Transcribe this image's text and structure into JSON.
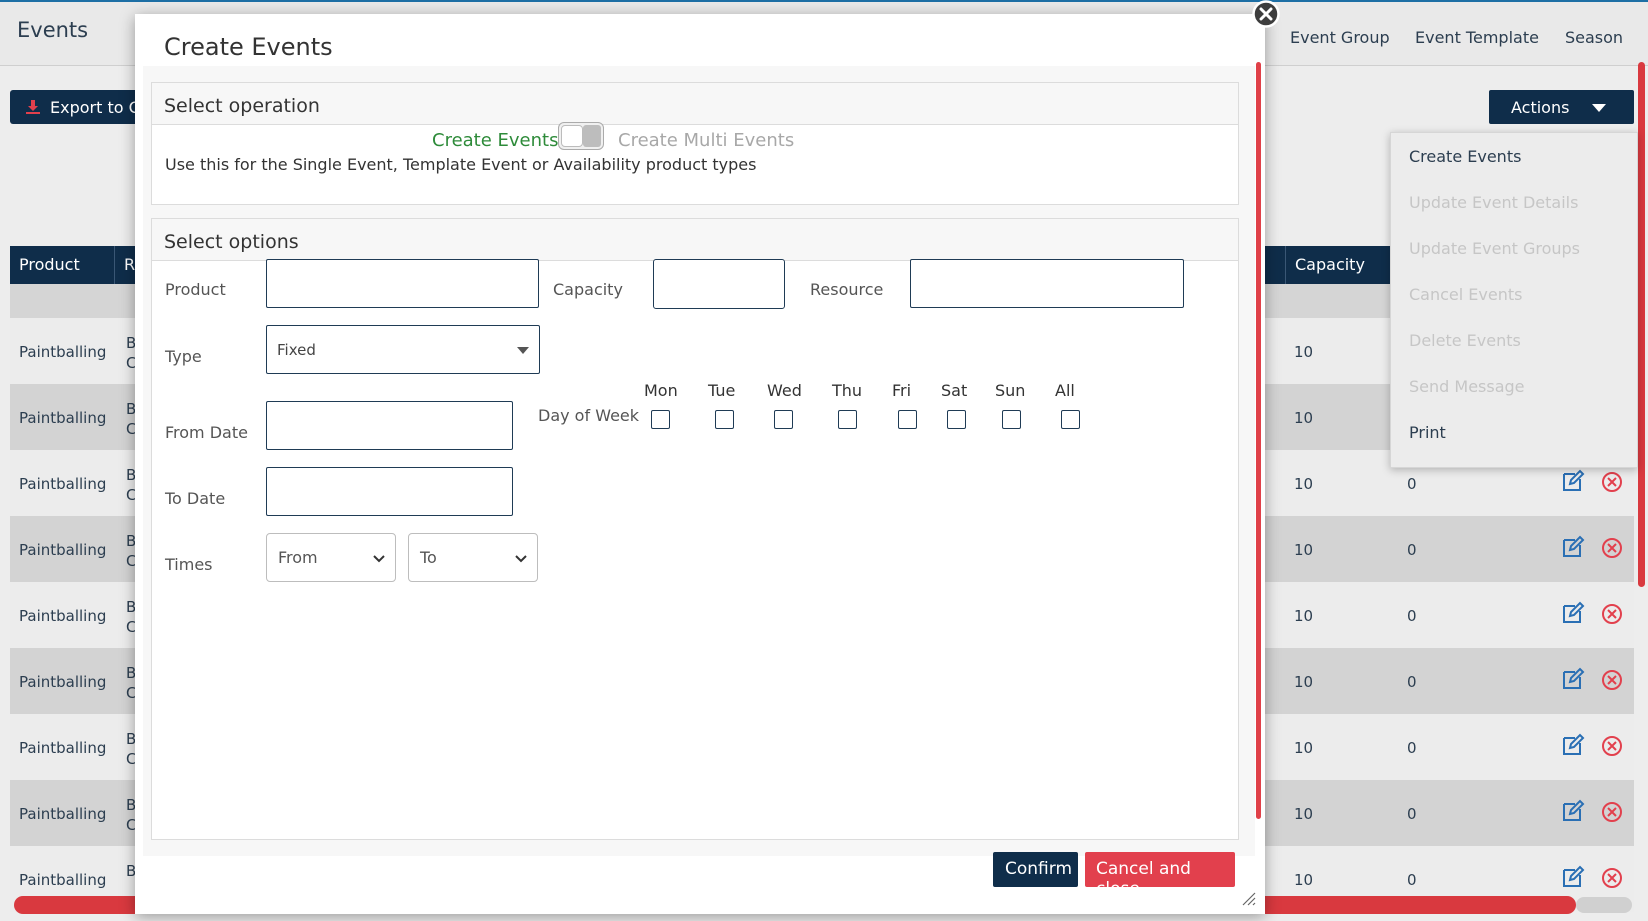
{
  "page": {
    "title": "Events",
    "nav": [
      "Event Group",
      "Event Template",
      "Season"
    ],
    "export_label": "Export to CS",
    "actions_label": "Actions",
    "actions_menu": [
      {
        "label": "Create Events",
        "enabled": true
      },
      {
        "label": "Update Event Details",
        "enabled": false
      },
      {
        "label": "Update Event Groups",
        "enabled": false
      },
      {
        "label": "Cancel Events",
        "enabled": false
      },
      {
        "label": "Delete Events",
        "enabled": false
      },
      {
        "label": "Send Message",
        "enabled": false
      },
      {
        "label": "Print",
        "enabled": true
      }
    ],
    "table": {
      "headers": {
        "product": "Product",
        "r": "R",
        "capacity": "Capacity"
      },
      "rows": [
        {
          "product": "Paintballing",
          "col2": "B",
          "col2b": "C",
          "capacity": "10",
          "booked": ""
        },
        {
          "product": "Paintballing",
          "col2": "B",
          "col2b": "C",
          "capacity": "10",
          "booked": ""
        },
        {
          "product": "Paintballing",
          "col2": "B",
          "col2b": "C",
          "capacity": "10",
          "booked": "0"
        },
        {
          "product": "Paintballing",
          "col2": "B",
          "col2b": "C",
          "capacity": "10",
          "booked": "0"
        },
        {
          "product": "Paintballing",
          "col2": "B",
          "col2b": "C",
          "capacity": "10",
          "booked": "0"
        },
        {
          "product": "Paintballing",
          "col2": "B",
          "col2b": "C",
          "capacity": "10",
          "booked": "0"
        },
        {
          "product": "Paintballing",
          "col2": "B",
          "col2b": "C",
          "capacity": "10",
          "booked": "0"
        },
        {
          "product": "Paintballing",
          "col2": "B",
          "col2b": "C",
          "capacity": "10",
          "booked": "0"
        },
        {
          "product": "Paintballing",
          "col2": "B",
          "col2b": "",
          "capacity": "10",
          "booked": "0"
        }
      ]
    }
  },
  "modal": {
    "title": "Create Events",
    "operation_section": "Select operation",
    "op_active": "Create Events",
    "op_inactive": "Create Multi Events",
    "op_description": "Use this for the Single Event, Template Event or Availability product types",
    "options_section": "Select options",
    "labels": {
      "product": "Product",
      "capacity": "Capacity",
      "resource": "Resource",
      "type": "Type",
      "from_date": "From Date",
      "to_date": "To Date",
      "day_of_week": "Day of Week",
      "times": "Times"
    },
    "type_value": "Fixed",
    "times_from": "From",
    "times_to": "To",
    "days": [
      "Mon",
      "Tue",
      "Wed",
      "Thu",
      "Fri",
      "Sat",
      "Sun",
      "All"
    ],
    "confirm_label": "Confirm",
    "cancel_label": "Cancel and close"
  },
  "colors": {
    "navy": "#0f2d4a",
    "danger": "#e2404d",
    "active_green": "#2e8b3a"
  }
}
